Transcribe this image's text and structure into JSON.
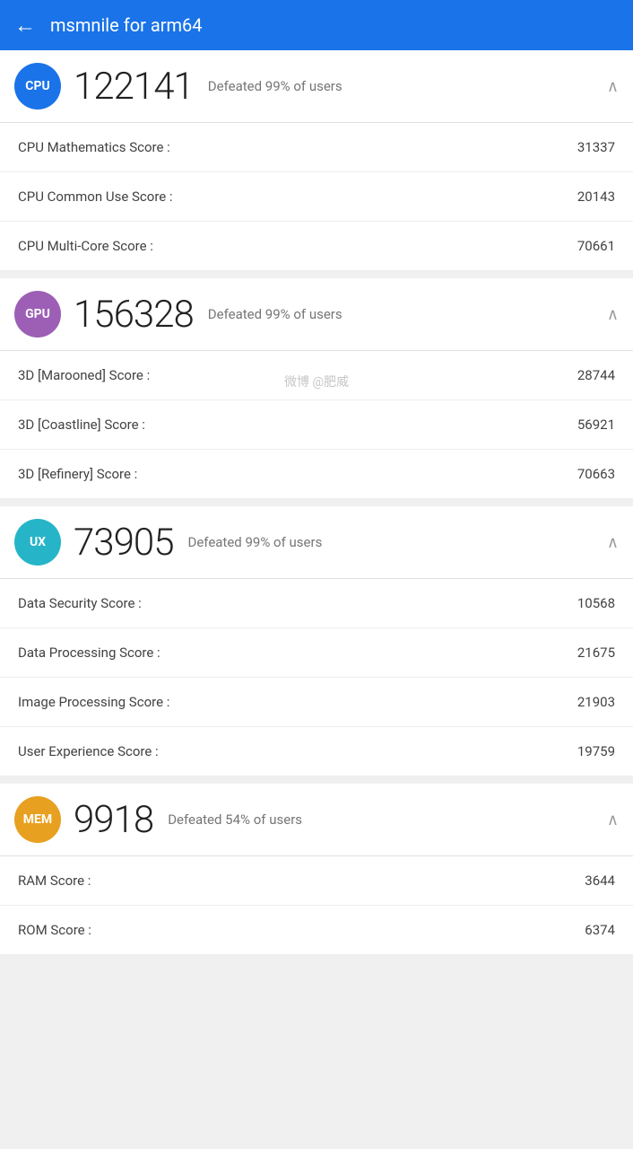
{
  "header": {
    "title": "msmnile for arm64",
    "back_icon": "←"
  },
  "cpu_top": {
    "badge_label": "CPU",
    "score": "122141",
    "defeated_text": "Defeated 99% of users",
    "chevron": "∧"
  },
  "cpu_details": [
    {
      "label": "CPU Mathematics Score :",
      "value": "31337"
    },
    {
      "label": "CPU Common Use Score :",
      "value": "20143"
    },
    {
      "label": "CPU Multi-Core Score :",
      "value": "70661"
    }
  ],
  "gpu_section": {
    "badge_label": "GPU",
    "score": "156328",
    "defeated_text": "Defeated 99% of users",
    "chevron": "∧"
  },
  "gpu_details": [
    {
      "label": "3D [Marooned] Score :",
      "value": "28744"
    },
    {
      "label": "3D [Coastline] Score :",
      "value": "56921"
    },
    {
      "label": "3D [Refinery] Score :",
      "value": "70663"
    }
  ],
  "watermark": "微博 @肥威",
  "ux_section": {
    "badge_label": "UX",
    "score": "73905",
    "defeated_text": "Defeated 99% of users",
    "chevron": "∧"
  },
  "ux_details": [
    {
      "label": "Data Security Score :",
      "value": "10568"
    },
    {
      "label": "Data Processing Score :",
      "value": "21675"
    },
    {
      "label": "Image Processing Score :",
      "value": "21903"
    },
    {
      "label": "User Experience Score :",
      "value": "19759"
    }
  ],
  "mem_section": {
    "badge_label": "MEM",
    "score": "9918",
    "defeated_text": "Defeated 54% of users",
    "chevron": "∧"
  },
  "mem_details": [
    {
      "label": "RAM Score :",
      "value": "3644"
    },
    {
      "label": "ROM Score :",
      "value": "6374"
    }
  ]
}
